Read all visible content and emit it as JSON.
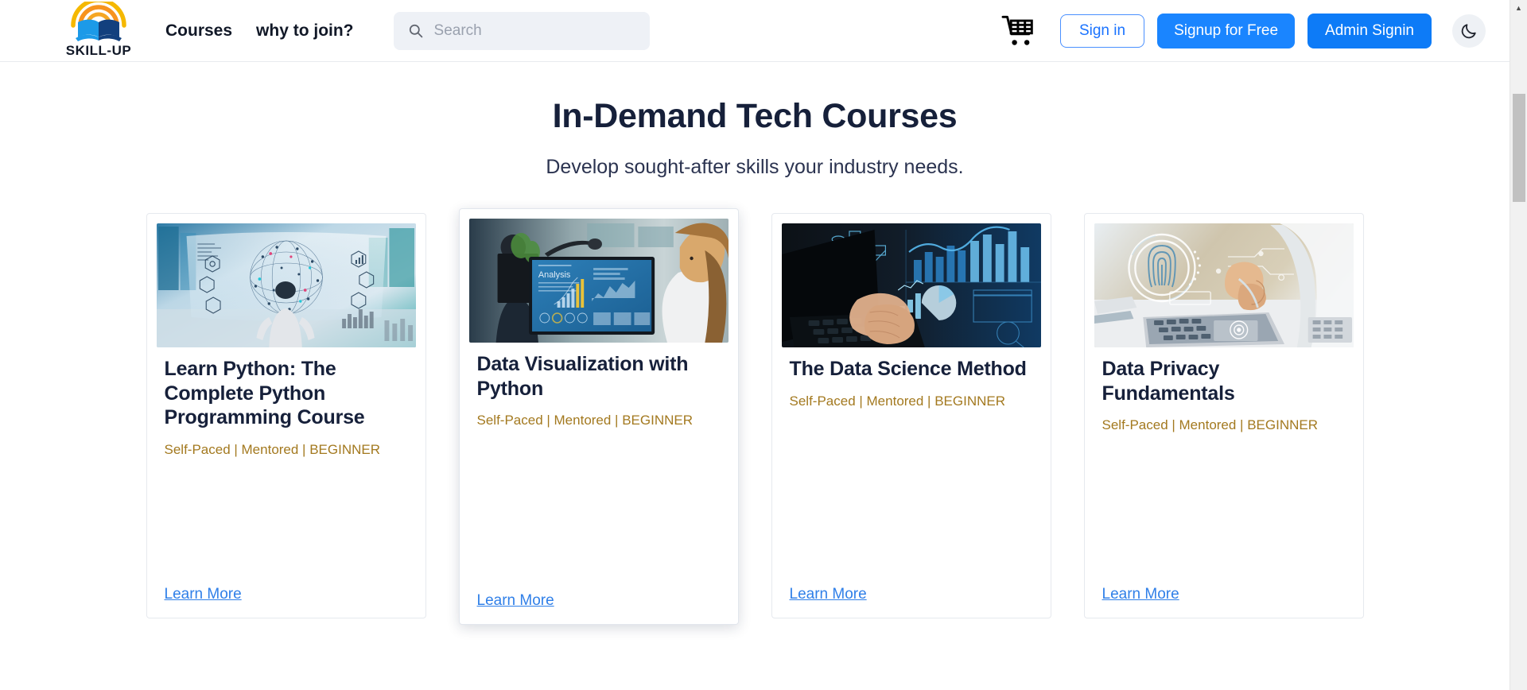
{
  "header": {
    "logo": {
      "text": "SKILL-UP",
      "icon": "open-book-rainbow-logo"
    },
    "nav": [
      {
        "label": "Courses",
        "name": "nav-courses"
      },
      {
        "label": "why to join?",
        "name": "nav-why-to-join"
      }
    ],
    "search": {
      "value": "",
      "placeholder": "Search",
      "icon": "search-icon"
    },
    "cart": {
      "icon": "shopping-cart-icon"
    },
    "buttons": {
      "sign_in": "Sign in",
      "signup": "Signup for Free",
      "admin": "Admin Signin"
    },
    "theme_toggle": {
      "icon": "moon-icon"
    }
  },
  "main": {
    "title": "In-Demand Tech Courses",
    "subtitle": "Develop sought-after skills your industry needs.",
    "learn_more_label": "Learn More",
    "courses": [
      {
        "title": "Learn Python: The Complete Python Programming Course",
        "meta": "Self-Paced | Mentored | BEGINNER",
        "image": "man-viewing-data-network-sphere",
        "raised": false
      },
      {
        "title": "Data Visualization with Python",
        "meta": "Self-Paced | Mentored | BEGINNER",
        "image": "woman-at-monitor-analysis-dashboard",
        "raised": true
      },
      {
        "title": "The Data Science Method",
        "meta": "Self-Paced | Mentored | BEGINNER",
        "image": "hands-on-laptop-with-blue-charts",
        "raised": false
      },
      {
        "title": "Data Privacy Fundamentals",
        "meta": "Self-Paced | Mentored | BEGINNER",
        "image": "fingerprint-biometric-security-laptop",
        "raised": false
      }
    ]
  },
  "scrollbar": {
    "up_arrow": "▲"
  },
  "colors": {
    "primary_blue": "#1a85ff",
    "admin_blue": "#0d7bf7",
    "link_blue": "#2f7fe8",
    "meta_gold": "#a3791f",
    "heading_navy": "#16203a",
    "search_bg": "#eef1f6"
  }
}
